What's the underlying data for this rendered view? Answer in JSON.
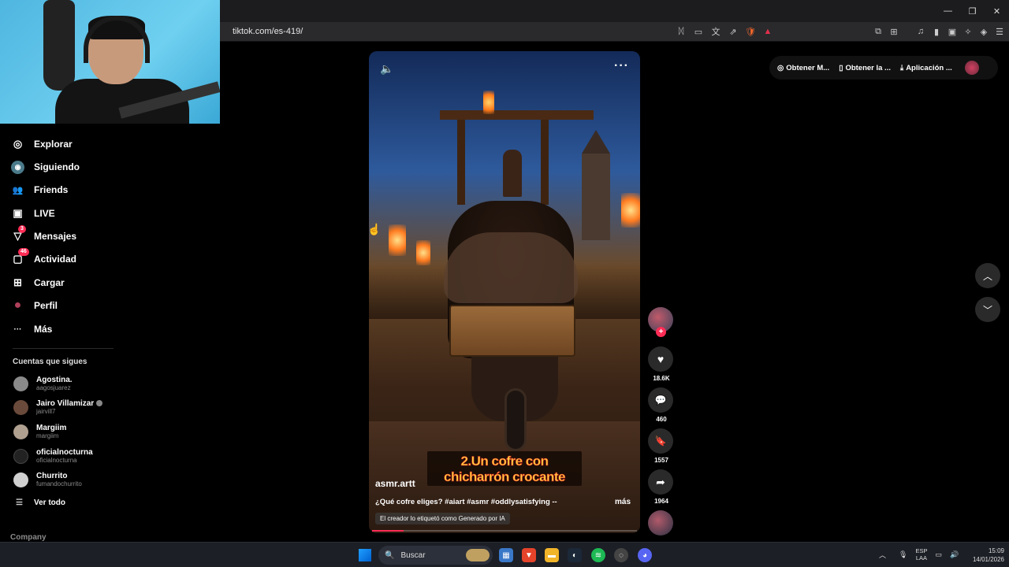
{
  "browser": {
    "url": "tiktok.com/es-419/",
    "window_controls": [
      "—",
      "❐",
      "✕"
    ],
    "address_icons": [
      "ᛞ",
      "▭",
      "文",
      "⇗",
      "🛡",
      "▲"
    ],
    "extension_icons": [
      "⧉",
      "⊞",
      "♫",
      "▮",
      "▣",
      "✧",
      "◈",
      "☰"
    ]
  },
  "sidebar": {
    "items": [
      {
        "label": "Explorar",
        "icon": "compass-icon",
        "glyph": "◎"
      },
      {
        "label": "Siguiendo",
        "icon": "following-avatar-icon",
        "glyph": "◉"
      },
      {
        "label": "Friends",
        "icon": "friends-icon",
        "glyph": "👥"
      },
      {
        "label": "LIVE",
        "icon": "live-icon",
        "glyph": "▣"
      },
      {
        "label": "Mensajes",
        "icon": "messages-icon",
        "glyph": "▽",
        "badge": "3"
      },
      {
        "label": "Actividad",
        "icon": "activity-icon",
        "glyph": "▢",
        "badge": "46"
      },
      {
        "label": "Cargar",
        "icon": "upload-icon",
        "glyph": "⊞"
      },
      {
        "label": "Perfil",
        "icon": "profile-avatar-icon",
        "glyph": "●"
      },
      {
        "label": "Más",
        "icon": "more-dots-icon",
        "glyph": "···"
      }
    ],
    "following_title": "Cuentas que sigues",
    "accounts": [
      {
        "name": "Agostina.",
        "user": "aagosjuarez",
        "color": "#8a8a8a"
      },
      {
        "name": "Jairo Villamizar",
        "user": "jairvill7",
        "color": "#6a4a3a"
      },
      {
        "name": "Margiim",
        "user": "margiim",
        "color": "#b0a090"
      },
      {
        "name": "oficialnocturna",
        "user": "oficialnocturna",
        "color": "#222222"
      },
      {
        "name": "Churrito",
        "user": "fumandochurrito",
        "color": "#d0d0d0"
      }
    ],
    "see_all": "Ver todo",
    "company": "Company"
  },
  "video": {
    "author": "asmr.artt",
    "description": "¿Qué cofre eliges? #aiart #asmr #oddlysatisfying --",
    "more": "más",
    "ai_label": "El creador lo etiquetó como Generado por IA",
    "caption_line1": "2.Un cofre con",
    "caption_line2": "chicharrón crocante",
    "progress": 0.12
  },
  "actions": {
    "likes": "18.6K",
    "comments": "460",
    "saves": "1557",
    "shares": "1964"
  },
  "top_right": {
    "coins": "Obtener M...",
    "app": "Obtener la ...",
    "download": "Aplicación ..."
  },
  "taskbar": {
    "search_placeholder": "Buscar",
    "lang_line1": "ESP",
    "lang_line2": "LAA",
    "time": "15:09",
    "date": "14/01/2026"
  },
  "colors": {
    "accent": "#fe2c55",
    "background": "#000000",
    "caption_yellow": "#ffd640"
  }
}
